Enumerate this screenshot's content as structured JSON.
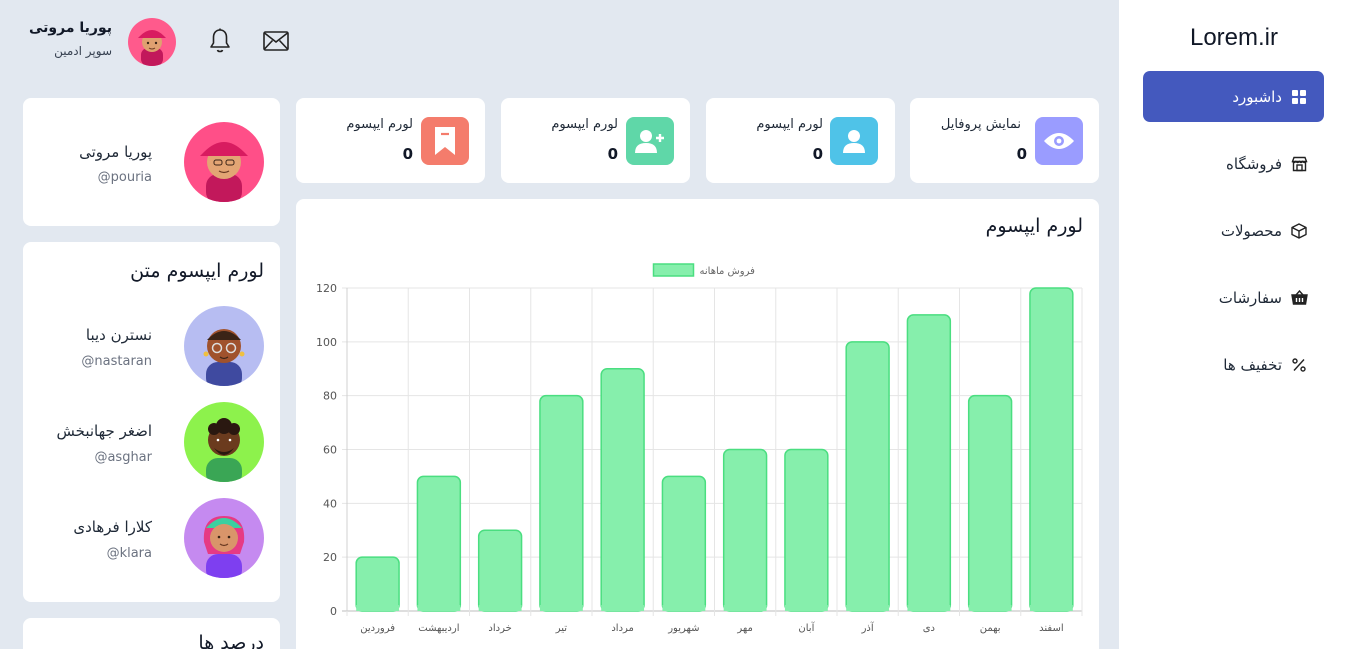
{
  "sidebar": {
    "brand": "Lorem.ir",
    "items": [
      {
        "label": "داشبورد",
        "icon": "grid-icon",
        "active": true
      },
      {
        "label": "فروشگاه",
        "icon": "store-icon",
        "active": false
      },
      {
        "label": "محصولات",
        "icon": "box-icon",
        "active": false
      },
      {
        "label": "سفارشات",
        "icon": "basket-icon",
        "active": false
      },
      {
        "label": "تخفیف ها",
        "icon": "percent-icon",
        "active": false
      }
    ]
  },
  "header": {
    "user_name": "پوریا مروتی",
    "user_role": "سوپر ادمین",
    "icons": [
      "bell-icon",
      "mail-icon"
    ]
  },
  "stats": [
    {
      "label": "نمایش پروفایل",
      "value": "0",
      "icon": "eye-icon",
      "color": "#8f93ff"
    },
    {
      "label": "لورم ایپسوم",
      "value": "0",
      "icon": "user-icon",
      "color": "#4fc3e8"
    },
    {
      "label": "لورم ایپسوم",
      "value": "0",
      "icon": "user-plus-icon",
      "color": "#5fd7a8"
    },
    {
      "label": "لورم ایپسوم",
      "value": "0",
      "icon": "bookmark-icon",
      "color": "#f47c6c"
    }
  ],
  "profile": {
    "name": "پوریا مروتی",
    "handle": "@pouria"
  },
  "people_card": {
    "title": "لورم ایپسوم متن",
    "people": [
      {
        "name": "نسترن دیبا",
        "handle": "@nastaran",
        "bg": "#b7bdf2"
      },
      {
        "name": "اضغر جهانبخش",
        "handle": "@asghar",
        "bg": "#8df24c"
      },
      {
        "name": "کلارا فرهادی",
        "handle": "@klara",
        "bg": "#c58af0"
      }
    ]
  },
  "bottom_card": {
    "title": "درصد ها"
  },
  "chart_card": {
    "title": "لورم ایپسوم"
  },
  "chart_data": {
    "type": "bar",
    "categories": [
      "فروردین",
      "اردیبهشت",
      "خرداد",
      "تیر",
      "مرداد",
      "شهریور",
      "مهر",
      "آبان",
      "آذر",
      "دی",
      "بهمن",
      "اسفند"
    ],
    "series": [
      {
        "name": "فروش ماهانه",
        "values": [
          20,
          50,
          30,
          80,
          90,
          50,
          60,
          60,
          100,
          110,
          80,
          120
        ]
      }
    ],
    "ylim": [
      0,
      120
    ],
    "yticks": [
      0,
      20,
      40,
      60,
      80,
      100,
      120
    ],
    "grid": true,
    "legend": "top",
    "bar_color": "#86efac",
    "bar_border": "#4ade80"
  },
  "colors": {
    "accent": "#4459be",
    "page_bg": "#e2e8f0"
  }
}
